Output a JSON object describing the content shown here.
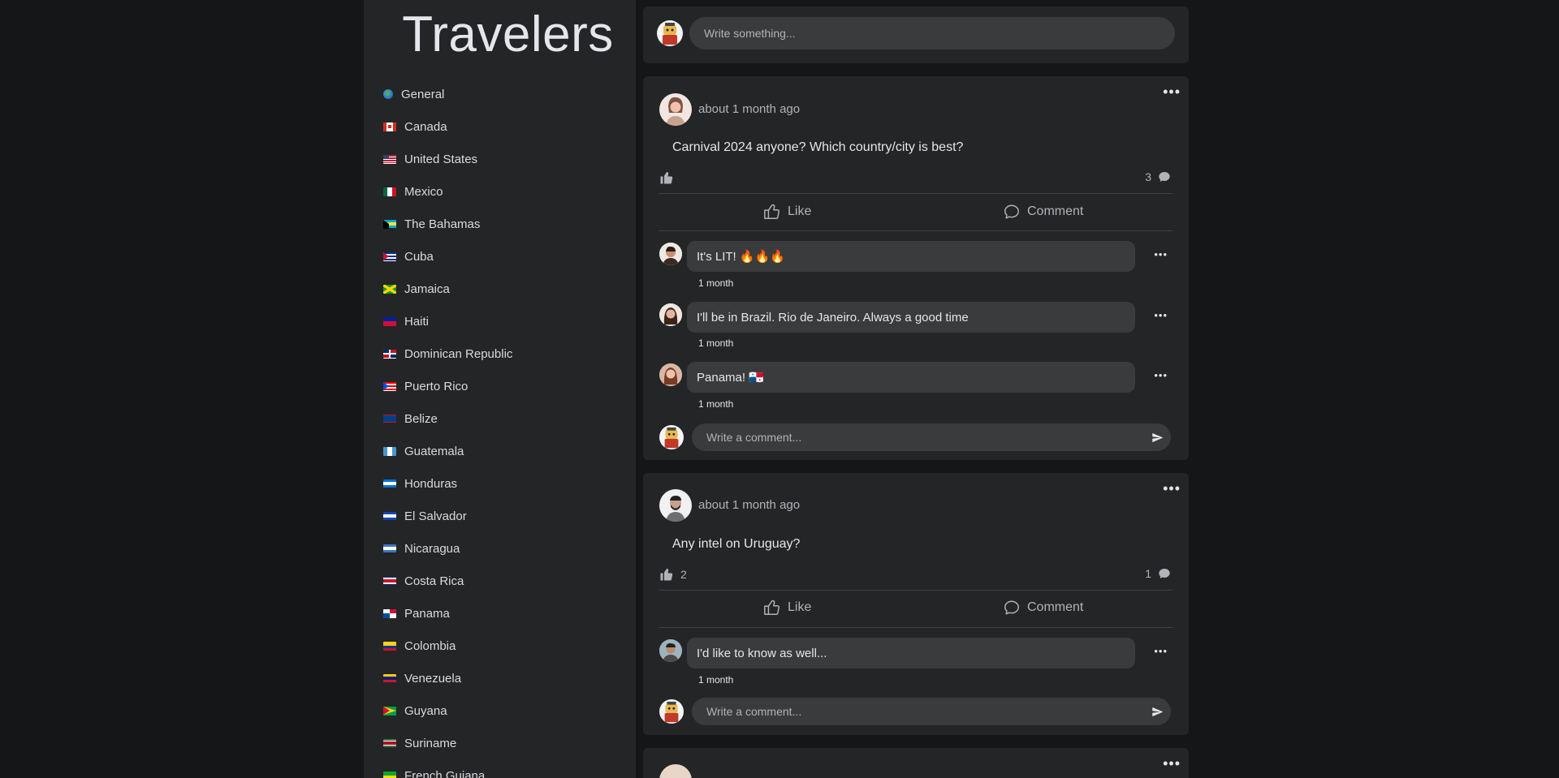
{
  "app": {
    "title": "Travelers"
  },
  "sidebar": {
    "items": [
      {
        "label": "General",
        "flag": "globe"
      },
      {
        "label": "Canada",
        "flag": "ca"
      },
      {
        "label": "United States",
        "flag": "us"
      },
      {
        "label": "Mexico",
        "flag": "mx"
      },
      {
        "label": "The Bahamas",
        "flag": "bs"
      },
      {
        "label": "Cuba",
        "flag": "cu"
      },
      {
        "label": "Jamaica",
        "flag": "jm"
      },
      {
        "label": "Haiti",
        "flag": "ht"
      },
      {
        "label": "Dominican Republic",
        "flag": "do"
      },
      {
        "label": "Puerto Rico",
        "flag": "pr"
      },
      {
        "label": "Belize",
        "flag": "bz"
      },
      {
        "label": "Guatemala",
        "flag": "gt"
      },
      {
        "label": "Honduras",
        "flag": "hn"
      },
      {
        "label": "El Salvador",
        "flag": "sv"
      },
      {
        "label": "Nicaragua",
        "flag": "ni"
      },
      {
        "label": "Costa Rica",
        "flag": "cr"
      },
      {
        "label": "Panama",
        "flag": "pa"
      },
      {
        "label": "Colombia",
        "flag": "co"
      },
      {
        "label": "Venezuela",
        "flag": "ve"
      },
      {
        "label": "Guyana",
        "flag": "gy"
      },
      {
        "label": "Suriname",
        "flag": "sr"
      },
      {
        "label": "French Guiana",
        "flag": "gf"
      }
    ]
  },
  "composer": {
    "placeholder": "Write something..."
  },
  "actions": {
    "like": "Like",
    "comment": "Comment",
    "comment_placeholder": "Write a comment..."
  },
  "posts": [
    {
      "time": "about 1 month ago",
      "text": "Carnival 2024 anyone? Which country/city is best?",
      "likes": "",
      "comments_count": "3",
      "comments": [
        {
          "text": "It's LIT! 🔥🔥🔥",
          "time": "1 month"
        },
        {
          "text": "I'll be in Brazil. Rio de Janeiro. Always a good time",
          "time": "1 month"
        },
        {
          "text": "Panama! 🇵🇦",
          "time": "1 month"
        }
      ]
    },
    {
      "time": "about 1 month ago",
      "text": "Any intel on Uruguay?",
      "likes": "2",
      "comments_count": "1",
      "comments": [
        {
          "text": "I'd like to know as well...",
          "time": "1 month"
        }
      ]
    }
  ],
  "colors": {
    "background": "#151617",
    "card": "#242526",
    "input": "#3a3b3c",
    "text": "#e4e6eb",
    "muted": "#b0b3b8"
  }
}
